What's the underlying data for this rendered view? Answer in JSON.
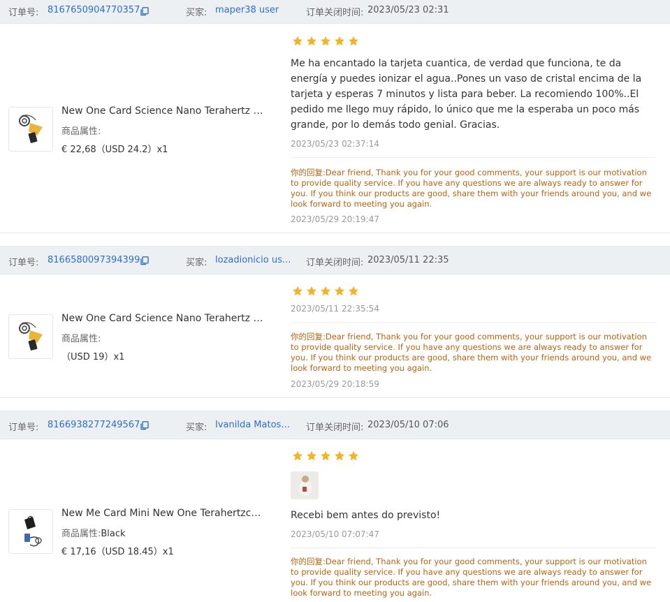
{
  "labels": {
    "order_no": "订单号:",
    "buyer": "买家:",
    "closed": "订单关闭时间:",
    "attr": "商品属性:",
    "reply": "你的回复:"
  },
  "orders": [
    {
      "order_id": "8167650904770357",
      "buyer": "maper38 user",
      "closed_time": "2023/05/23 02:31",
      "product_name": "New One Card Science Nano Terahertz T...",
      "attr_value": "",
      "price": "€ 22,68（USD  24.2）x1",
      "rating": 5,
      "review_text": "Me ha encantado la tarjeta cuantica, de verdad que funciona, te da energía y puedes ionizar el agua..Pones un vaso de cristal encima de la tarjeta y esperas 7 minutos y lista para beber. La recomiendo 100%..El pedido me llego muy rápido, lo único que me la esperaba un poco más grande, por lo demás todo genial. Gracias.",
      "review_time": "2023/05/23 02:37:14",
      "reply_text": "Dear friend, Thank you for your good comments, your support is our motivation to provide quality service. If you have any questions we are always ready to answer for you. If you think our products are good, share them with your friends around you, and we look forward to meeting you again.",
      "reply_time": "2023/05/29 20:19:47"
    },
    {
      "order_id": "8166580097394399",
      "buyer": "lozadionicio us...",
      "closed_time": "2023/05/11 22:35",
      "product_name": "New One Card Science Nano Terahertz T...",
      "attr_value": "",
      "price": "（USD  19）x1",
      "rating": 5,
      "review_text": "",
      "review_time": "2023/05/11 22:35:54",
      "reply_text": "Dear friend, Thank you for your good comments, your support is our motivation to provide quality service. If you have any questions we are always ready to answer for you. If you think our products are good, share them with your friends around you, and we look forward to meeting you again.",
      "reply_time": "2023/05/29 20:18:59"
    },
    {
      "order_id": "8166938277249567",
      "buyer": "Ivanilda Matos...",
      "closed_time": "2023/05/10 07:06",
      "product_name": "New Me Card Mini New One Terahertzchi...",
      "attr_value": "Black",
      "price": "€ 17,16（USD  18.45）x1",
      "rating": 5,
      "review_text": "Recebi bem antes do previsto!",
      "review_time": "2023/05/10 07:07:47",
      "reply_text": "Dear friend, Thank you for your good comments, your support is our motivation to provide quality service. If you have any questions we are always ready to answer for you. If you think our products are good, share them with your friends around you, and we look forward to meeting you again.",
      "reply_time": ""
    }
  ],
  "colors": {
    "star": "#f5b324",
    "link": "#2c6ecb",
    "reply": "#b8620f",
    "header_bg": "#edf0f3"
  },
  "icons": {
    "copy": "copy-icon",
    "star": "star-icon"
  }
}
